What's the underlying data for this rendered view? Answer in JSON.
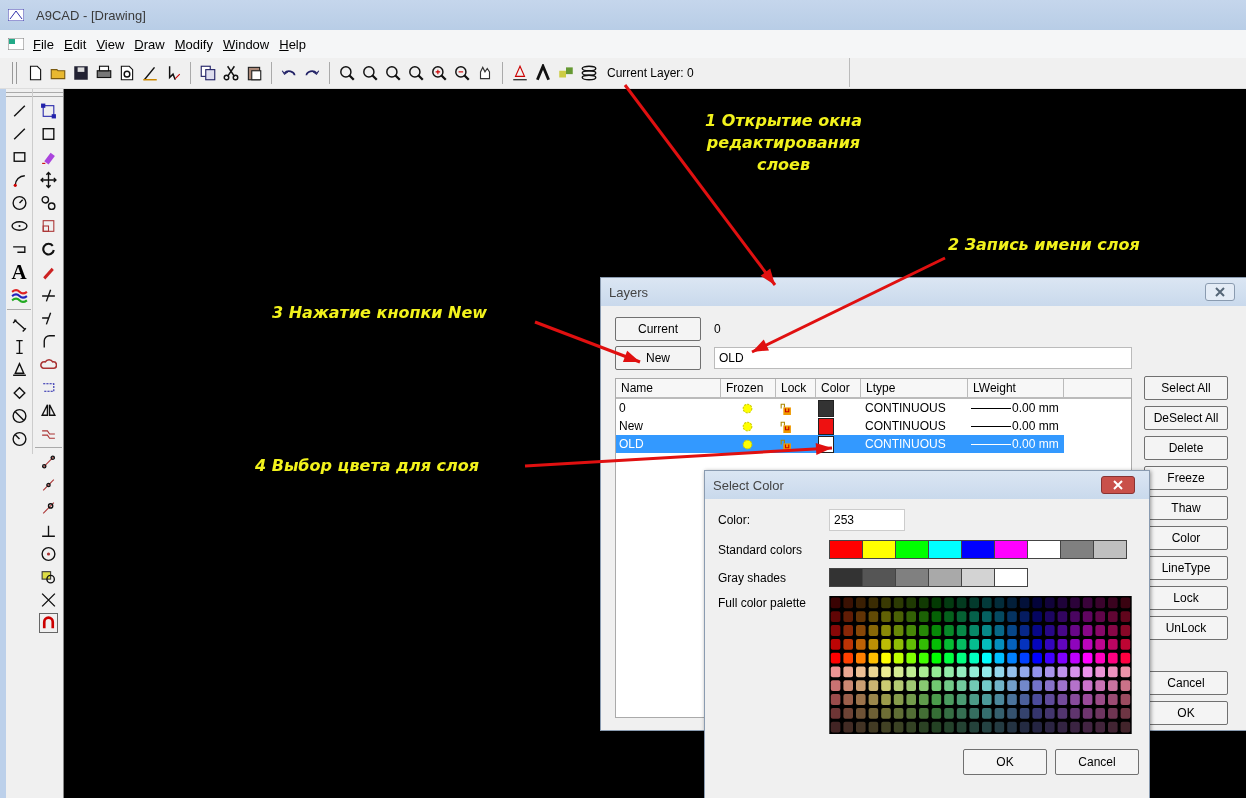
{
  "window": {
    "title": "A9CAD - [Drawing]"
  },
  "menu": [
    "File",
    "Edit",
    "View",
    "Draw",
    "Modify",
    "Window",
    "Help"
  ],
  "toolbar": {
    "current_layer": "Current Layer: 0"
  },
  "left_toolbar": {
    "text_glyph": "A"
  },
  "annotations": [
    {
      "lines": [
        "1 Открытие окна",
        "редактирования",
        "слоев"
      ]
    },
    {
      "lines": [
        "2 Запись имени слоя"
      ]
    },
    {
      "lines": [
        "3 Нажатие кнопки New"
      ]
    },
    {
      "lines": [
        "4 Выбор цвета для слоя"
      ]
    }
  ],
  "layers_dialog": {
    "title": "Layers",
    "current_button": "Current",
    "current_value": "0",
    "new_button": "New",
    "name_field": "OLD",
    "columns": [
      "Name",
      "Frozen",
      "Lock",
      "Color",
      "Ltype",
      "LWeight"
    ],
    "rows": [
      {
        "name": "0",
        "color": "#333333",
        "ltype": "CONTINUOUS",
        "lweight": "0.00 mm",
        "selected": false
      },
      {
        "name": "New",
        "color": "#ee1111",
        "ltype": "CONTINUOUS",
        "lweight": "0.00 mm",
        "selected": false
      },
      {
        "name": "OLD",
        "color": "#ffffff",
        "ltype": "CONTINUOUS",
        "lweight": "0.00 mm",
        "selected": true
      }
    ],
    "side_buttons": [
      "Select All",
      "DeSelect All",
      "Delete",
      "Freeze",
      "Thaw",
      "Color",
      "LineType",
      "Lock",
      "UnLock"
    ],
    "footer_buttons": [
      "Cancel",
      "OK"
    ]
  },
  "select_color_dialog": {
    "title": "Select Color",
    "color_label": "Color:",
    "color_value": "253",
    "standard_label": "Standard colors",
    "standard_colors": [
      {
        "color": "#ff0000"
      },
      {
        "color": "#ffff00"
      },
      {
        "color": "#00ff00"
      },
      {
        "color": "#00ffff"
      },
      {
        "color": "#0000ff"
      },
      {
        "color": "#ff00ff"
      },
      {
        "color": "#ffffff"
      },
      {
        "color": "#808080"
      },
      {
        "color": "#c0c0c0"
      }
    ],
    "gray_label": "Gray shades",
    "gray_shades": [
      {
        "color": "#333333"
      },
      {
        "color": "#555555"
      },
      {
        "color": "#808080"
      },
      {
        "color": "#a9a9a9"
      },
      {
        "color": "#d3d3d3"
      },
      {
        "color": "#ffffff"
      }
    ],
    "palette_label": "Full color palette",
    "buttons": [
      "OK",
      "Cancel"
    ]
  }
}
